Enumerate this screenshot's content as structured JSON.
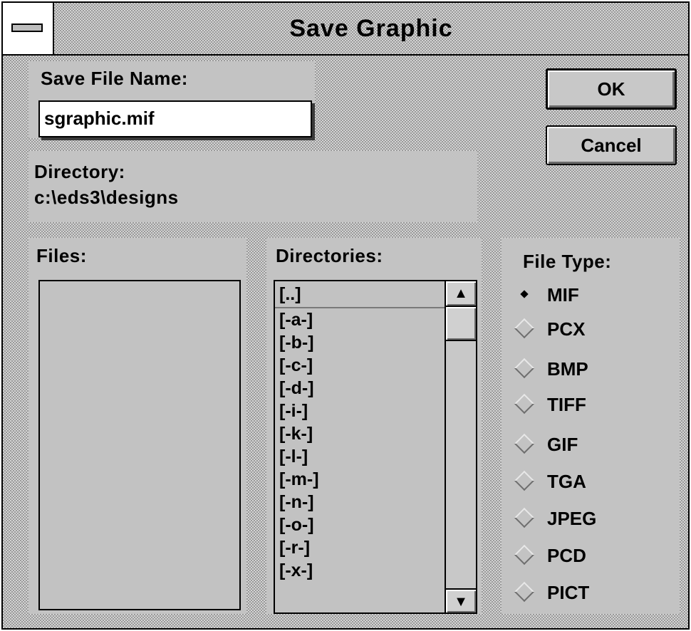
{
  "dialog": {
    "title": "Save Graphic",
    "system_menu_icon": "system-menu-bar-icon"
  },
  "save_file": {
    "label": "Save File Name:",
    "value": "sgraphic.mif"
  },
  "directory": {
    "label": "Directory:",
    "path": "c:\\eds3\\designs"
  },
  "buttons": {
    "ok": "OK",
    "cancel": "Cancel"
  },
  "files": {
    "label": "Files:",
    "items": []
  },
  "directories": {
    "label": "Directories:",
    "items": [
      "[..]",
      "[-a-]",
      "[-b-]",
      "[-c-]",
      "[-d-]",
      "[-i-]",
      "[-k-]",
      "[-l-]",
      "[-m-]",
      "[-n-]",
      "[-o-]",
      "[-r-]",
      "[-x-]"
    ],
    "scroll_up_icon": "up-arrow-icon",
    "scroll_down_icon": "down-arrow-icon"
  },
  "file_type": {
    "label": "File Type:",
    "options": [
      "MIF",
      "PCX",
      "BMP",
      "TIFF",
      "GIF",
      "TGA",
      "JPEG",
      "PCD",
      "PICT"
    ],
    "selected": "MIF"
  }
}
